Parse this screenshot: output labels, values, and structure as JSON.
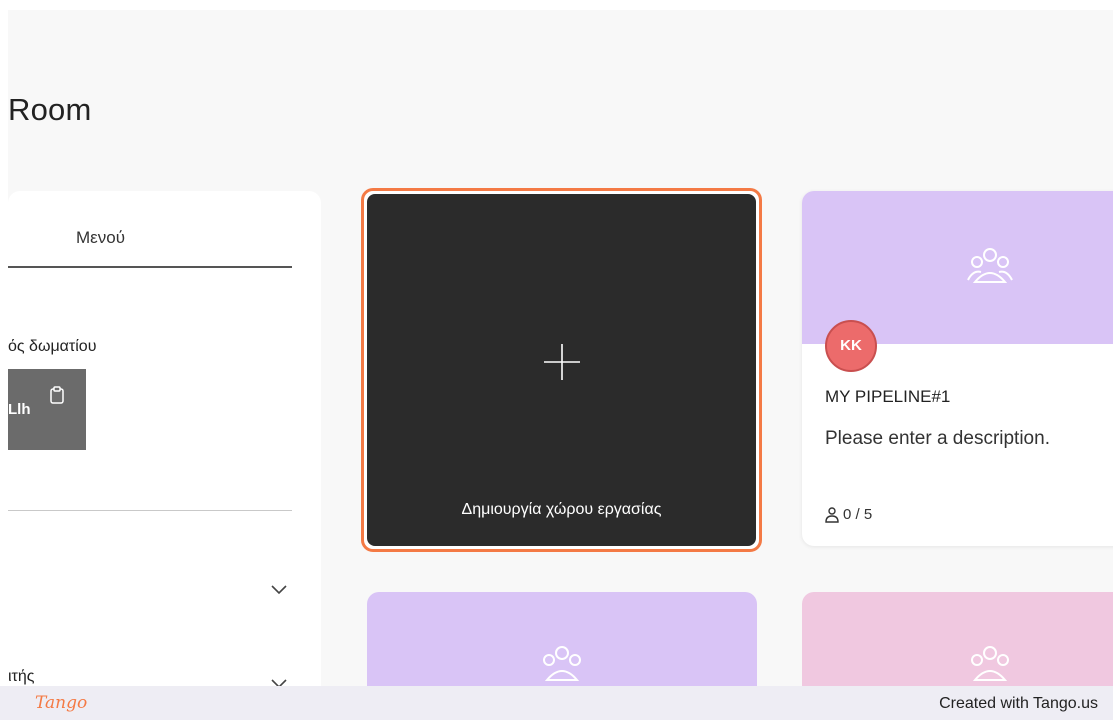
{
  "page": {
    "title": "Room"
  },
  "side_panel": {
    "tab_label": "Μενού",
    "room_code_label": "ός δωματίου",
    "room_code_value": "Llh",
    "collapsed_item_2_label": "ιτής"
  },
  "create_card": {
    "label": "Δημιουργία χώρου εργασίας",
    "accent_color": "#f47a45"
  },
  "workspace_card": {
    "avatar_initials": "KK",
    "title": "MY PIPELINE#1",
    "description": "Please enter a description.",
    "members": "0 / 5",
    "banner_color": "#d9c4f6"
  },
  "lower_cards": [
    {
      "banner_color": "#d9c4f6"
    },
    {
      "banner_color": "#f0c8e0"
    }
  ],
  "footer": {
    "logo_text": "Tango",
    "credit": "Created with Tango.us"
  }
}
